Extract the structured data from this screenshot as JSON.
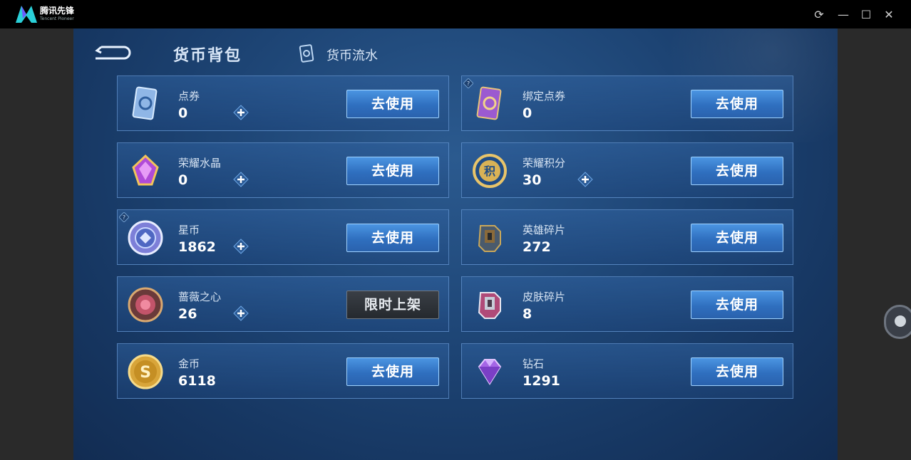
{
  "window": {
    "app_name": "腾讯先锋",
    "app_sub": "Tencent Pioneer"
  },
  "header": {
    "title": "货币背包",
    "flow_link": "货币流水"
  },
  "colors": {
    "accent": "#3b82d4",
    "panel": "#1d4474"
  },
  "currencies": [
    {
      "name": "点券",
      "value": "0",
      "has_plus": true,
      "button": "去使用",
      "icon": "ticket-card-icon"
    },
    {
      "name": "绑定点券",
      "value": "0",
      "has_plus": false,
      "button": "去使用",
      "icon": "bound-ticket-icon",
      "help": true
    },
    {
      "name": "荣耀水晶",
      "value": "0",
      "has_plus": true,
      "button": "去使用",
      "icon": "crystal-icon"
    },
    {
      "name": "荣耀积分",
      "value": "30",
      "has_plus": true,
      "button": "去使用",
      "icon": "honor-points-icon"
    },
    {
      "name": "星币",
      "value": "1862",
      "has_plus": true,
      "button": "去使用",
      "icon": "star-coin-icon",
      "help": true
    },
    {
      "name": "英雄碎片",
      "value": "272",
      "has_plus": false,
      "button": "去使用",
      "icon": "hero-shard-icon"
    },
    {
      "name": "蔷薇之心",
      "value": "26",
      "has_plus": true,
      "button": "限时上架",
      "icon": "rose-heart-icon"
    },
    {
      "name": "皮肤碎片",
      "value": "8",
      "has_plus": false,
      "button": "去使用",
      "icon": "skin-shard-icon"
    },
    {
      "name": "金币",
      "value": "6118",
      "has_plus": false,
      "button": "去使用",
      "icon": "gold-coin-icon"
    },
    {
      "name": "钻石",
      "value": "1291",
      "has_plus": false,
      "button": "去使用",
      "icon": "diamond-icon"
    }
  ]
}
